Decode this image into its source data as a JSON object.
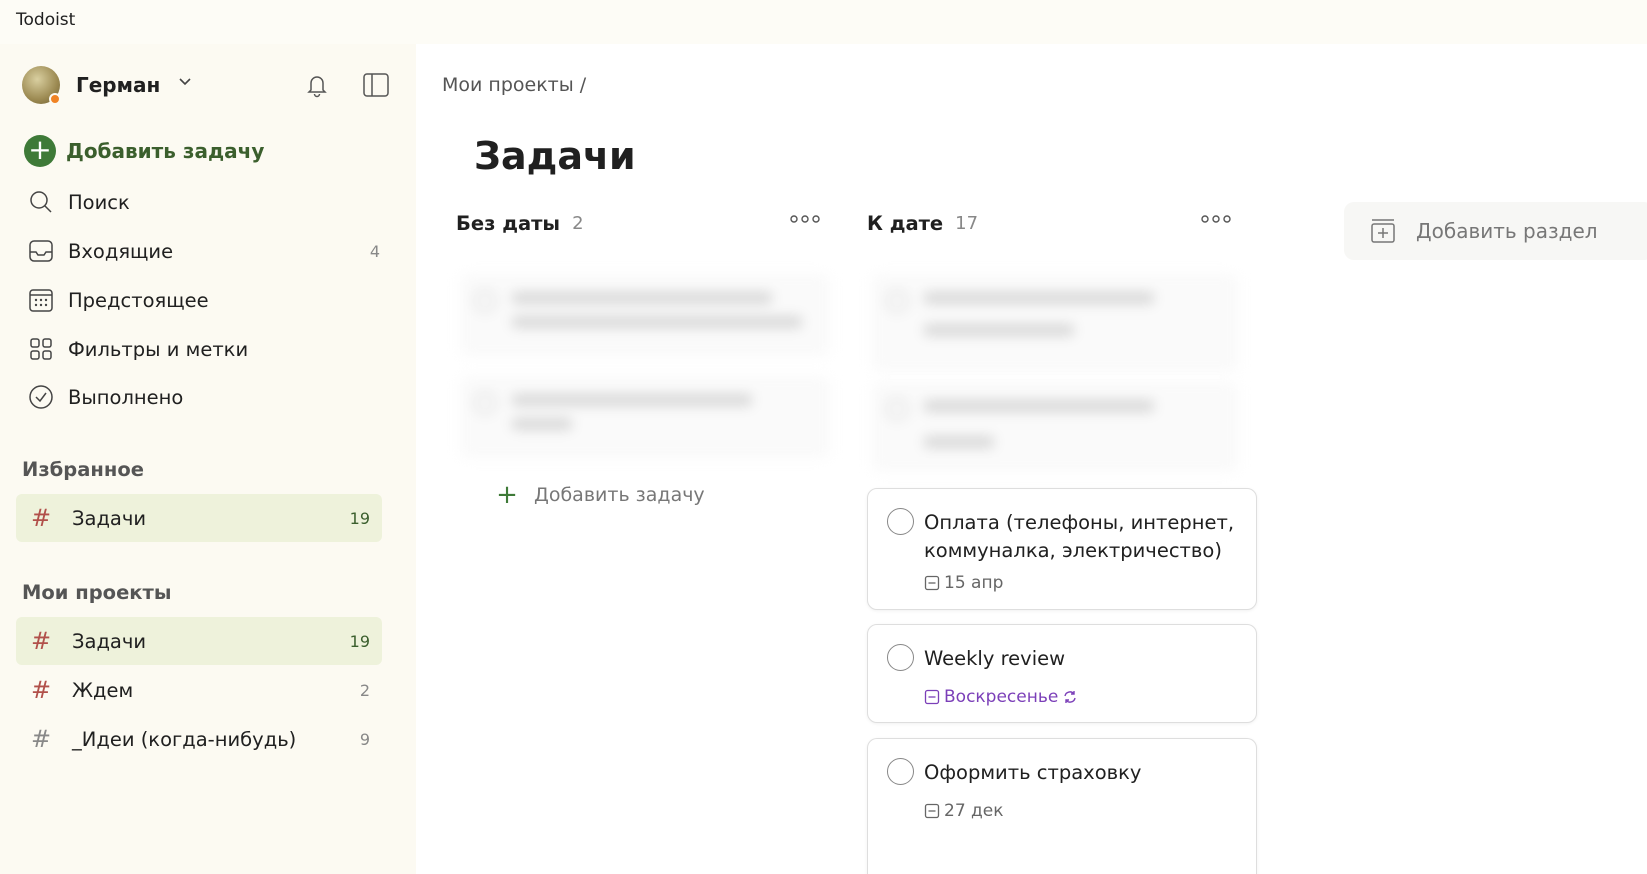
{
  "window": {
    "title": "Todoist"
  },
  "sidebar": {
    "user": {
      "name": "Герман"
    },
    "add_task_label": "Добавить задачу",
    "nav": [
      {
        "id": "search",
        "label": "Поиск",
        "icon": "search-icon",
        "count": ""
      },
      {
        "id": "inbox",
        "label": "Входящие",
        "icon": "inbox-icon",
        "count": "4"
      },
      {
        "id": "upcoming",
        "label": "Предстоящее",
        "icon": "calendar-icon",
        "count": ""
      },
      {
        "id": "filters",
        "label": "Фильтры и метки",
        "icon": "filters-icon",
        "count": ""
      },
      {
        "id": "completed",
        "label": "Выполнено",
        "icon": "check-circle-icon",
        "count": ""
      }
    ],
    "favorites_header": "Избранное",
    "favorites": [
      {
        "label": "Задачи",
        "count": "19",
        "active": true
      }
    ],
    "projects_header": "Мои проекты",
    "projects": [
      {
        "label": "Задачи",
        "count": "19",
        "active": true
      },
      {
        "label": "Ждем",
        "count": "2",
        "active": false
      },
      {
        "label": "_Идеи (когда-нибудь)",
        "count": "9",
        "active": false
      }
    ]
  },
  "main": {
    "breadcrumb": "Мои проекты /",
    "title": "Задачи",
    "columns": [
      {
        "title": "Без даты",
        "count": "2",
        "add_task_label": "Добавить задачу"
      },
      {
        "title": "К дате",
        "count": "17"
      }
    ],
    "tasks": [
      {
        "title": "Оплата (телефоны, интернет, коммуналка, электричество)",
        "date": "15 апр",
        "recurring": false
      },
      {
        "title": "Weekly review",
        "date": "Воскресенье",
        "recurring": true
      },
      {
        "title": "Оформить страховку",
        "date": "27 дек",
        "recurring": false
      }
    ],
    "add_section_label": "Добавить раздел"
  },
  "colors": {
    "accent_green": "#3e7a38",
    "hash_red": "#b1504a",
    "recurring_purple": "#7b3fb8",
    "active_bg": "#eef2db"
  }
}
